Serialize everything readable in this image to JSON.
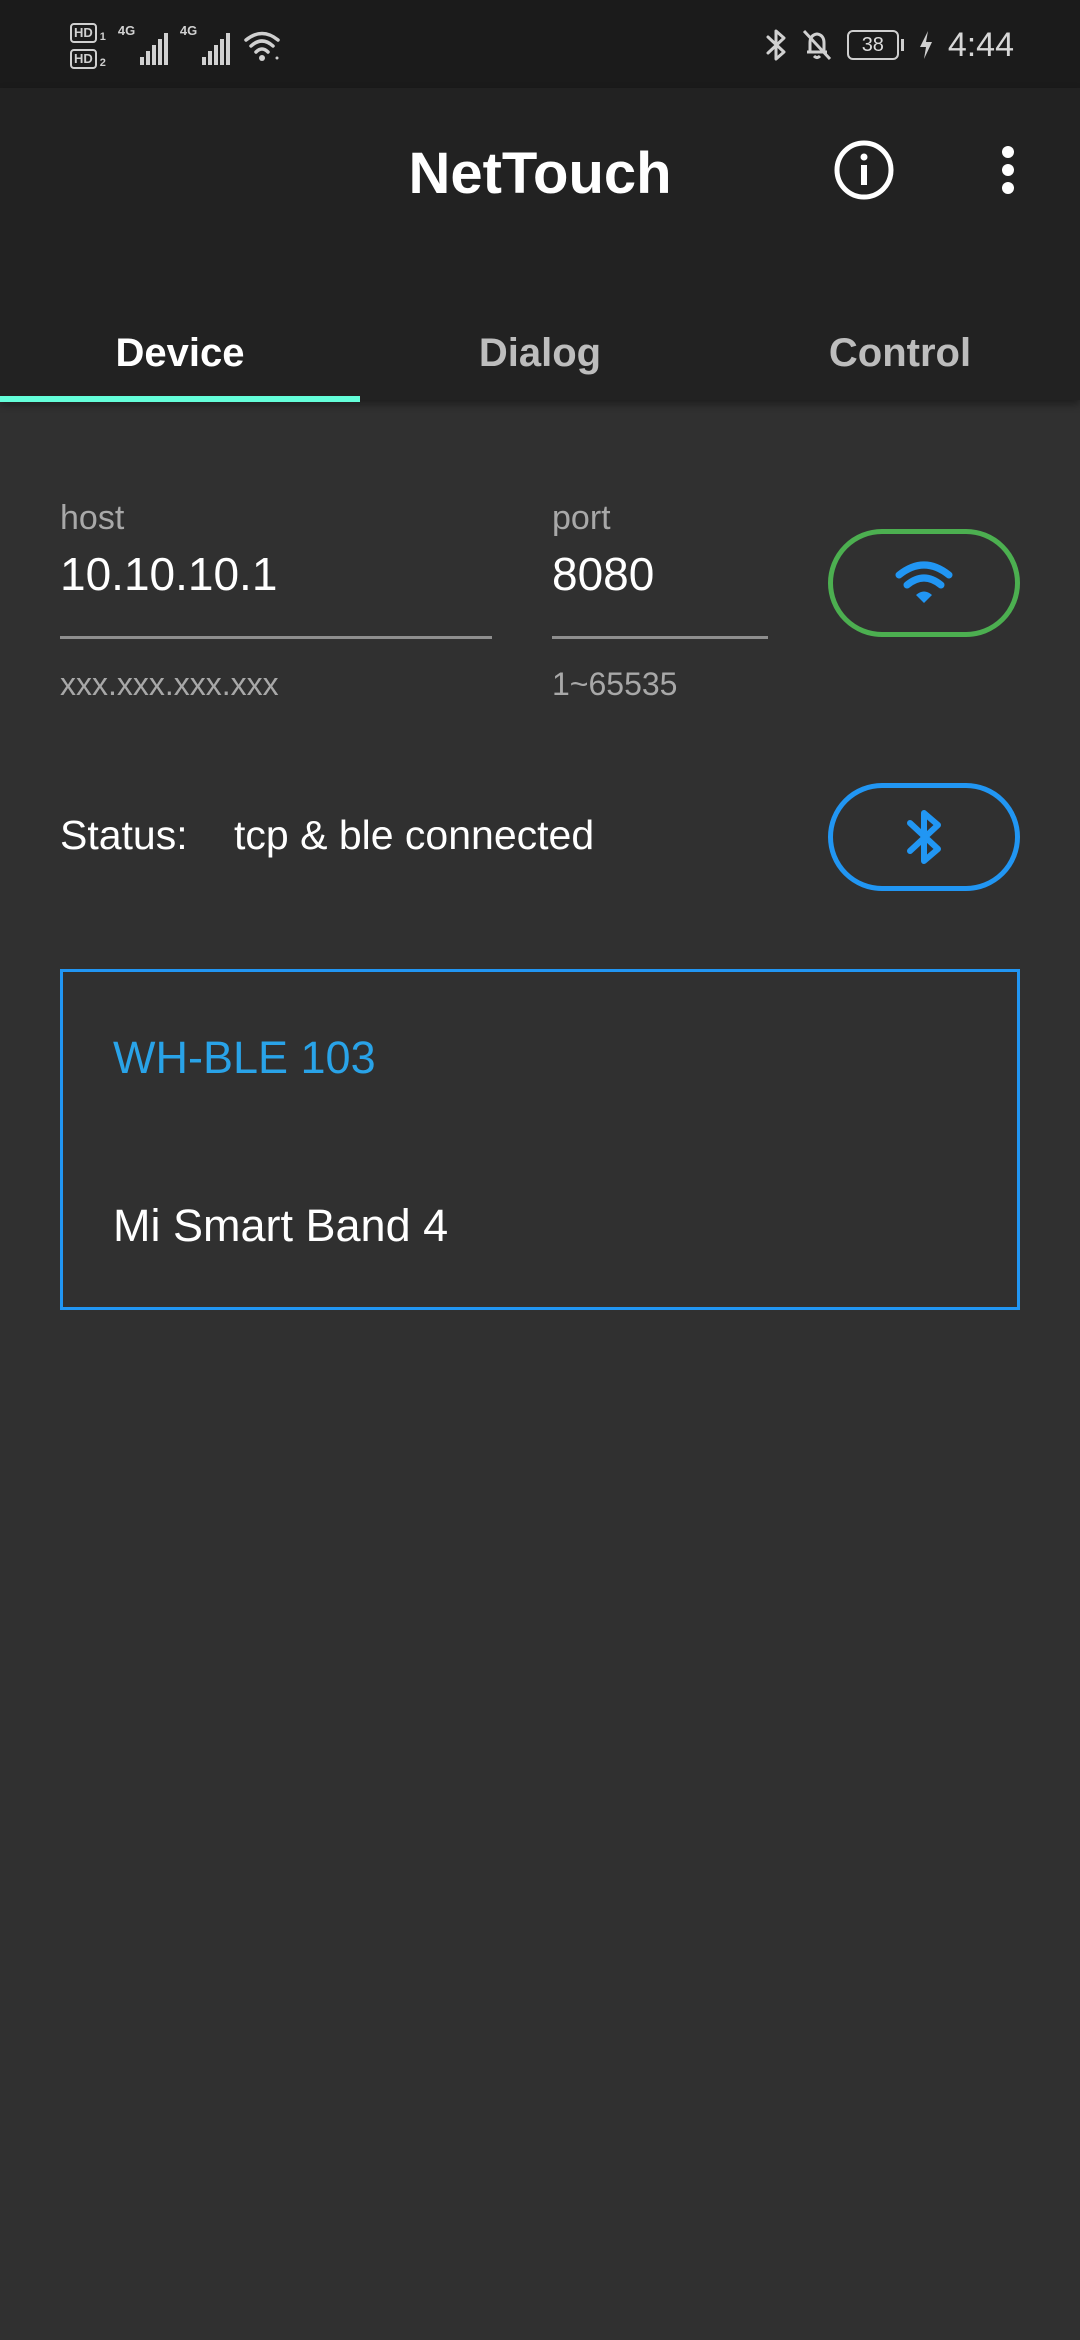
{
  "status_bar": {
    "sim1": {
      "label": "HD",
      "slot": "1",
      "network": "4G"
    },
    "sim2": {
      "label": "HD",
      "slot": "2",
      "network": "4G"
    },
    "battery": "38",
    "time": "4:44",
    "icons": [
      "wifi-icon",
      "bluetooth-icon",
      "bell-off-icon",
      "battery-icon",
      "charging-icon"
    ]
  },
  "app_bar": {
    "title": "NetTouch",
    "info_icon": "info-icon",
    "more_icon": "more-vert-icon"
  },
  "tabs": [
    {
      "label": "Device",
      "active": true
    },
    {
      "label": "Dialog",
      "active": false
    },
    {
      "label": "Control",
      "active": false
    }
  ],
  "connection": {
    "host": {
      "label": "host",
      "value": "10.10.10.1",
      "hint": "xxx.xxx.xxx.xxx"
    },
    "port": {
      "label": "port",
      "value": "8080",
      "hint": "1~65535"
    },
    "wifi_button": {
      "icon": "wifi-icon",
      "color": "#4caf50"
    },
    "ble_button": {
      "icon": "bluetooth-icon",
      "color": "#2196f3"
    },
    "status_label": "Status:",
    "status_value": "tcp & ble connected"
  },
  "devices": [
    {
      "name": "WH-BLE 103",
      "selected": true
    },
    {
      "name": "Mi Smart Band 4",
      "selected": false
    }
  ],
  "colors": {
    "accent": "#64ffda",
    "selected_device": "#29a3e8",
    "list_border": "#2196f3"
  }
}
